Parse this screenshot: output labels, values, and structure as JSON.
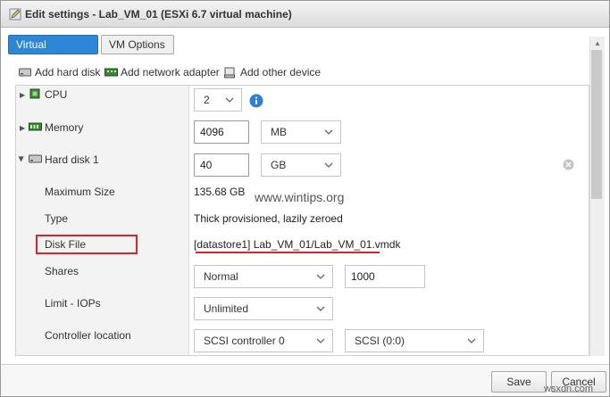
{
  "window": {
    "title": "Edit settings - Lab_VM_01 (ESXi 6.7 virtual machine)"
  },
  "tabs": [
    {
      "label": "Virtual Hardware",
      "active": true
    },
    {
      "label": "VM Options",
      "active": false
    }
  ],
  "toolbar": {
    "add_hard_disk": "Add hard disk",
    "add_network_adapter": "Add network adapter",
    "add_other_device": "Add other device"
  },
  "cpu": {
    "label": "CPU",
    "value": "2"
  },
  "memory": {
    "label": "Memory",
    "value": "4096",
    "unit": "MB"
  },
  "hard_disk": {
    "label": "Hard disk 1",
    "size": "40",
    "unit": "GB",
    "maximum_size_label": "Maximum Size",
    "maximum_size_value": "135.68 GB",
    "type_label": "Type",
    "type_value": "Thick provisioned, lazily zeroed",
    "disk_file_label": "Disk File",
    "disk_file_value": "[datastore1] Lab_VM_01/Lab_VM_01.vmdk",
    "shares_label": "Shares",
    "shares_level": "Normal",
    "shares_value": "1000",
    "limit_label": "Limit - IOPs",
    "limit_value": "Unlimited",
    "controller_label": "Controller location",
    "controller_value": "SCSI controller 0",
    "controller_slot": "SCSI (0:0)"
  },
  "footer": {
    "save_label": "Save",
    "cancel_label": "Cancel"
  },
  "watermark": {
    "text": "www.wintips.org",
    "badge": "wsxdn.com"
  },
  "colors": {
    "accent": "#2e86d8",
    "annotation": "#e0232b",
    "info": "#2b7fd6",
    "memory_green": "#3a8a2f"
  }
}
